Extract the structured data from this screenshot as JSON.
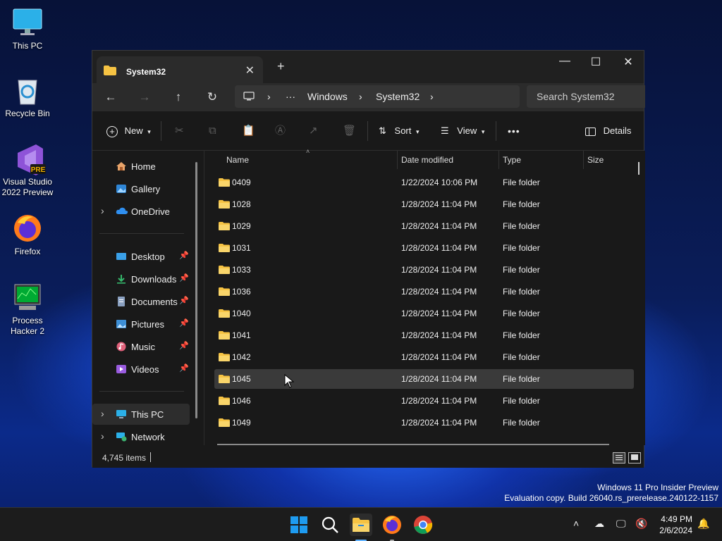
{
  "desktop": {
    "icons": [
      {
        "label": "This PC",
        "icon": "monitor-icon"
      },
      {
        "label": "Recycle Bin",
        "icon": "recycle-bin-icon"
      },
      {
        "label": "Visual Studio 2022 Preview",
        "icon": "visual-studio-icon",
        "badge": "PRE"
      },
      {
        "label": "Firefox",
        "icon": "firefox-icon"
      },
      {
        "label": "Process Hacker 2",
        "icon": "process-hacker-icon"
      }
    ],
    "watermark": {
      "line1": "Windows 11 Pro Insider Preview",
      "line2": "Evaluation copy. Build 26040.rs_prerelease.240122-1157"
    }
  },
  "explorer": {
    "tab_title": "System32",
    "tab_close": "✕",
    "new_tab": "+",
    "window_controls": {
      "minimize": "—",
      "maximize": "☐",
      "close": "✕"
    },
    "nav": {
      "back": "←",
      "forward": "→",
      "up": "↑",
      "refresh": "↻"
    },
    "breadcrumb": {
      "ellipsis": "···",
      "items": [
        "Windows",
        "System32"
      ],
      "separator": "›"
    },
    "search_placeholder": "Search System32",
    "toolbar": {
      "new_label": "New",
      "sort_label": "Sort",
      "view_label": "View",
      "more_label": "•••",
      "details_label": "Details"
    },
    "sidebar": {
      "top": [
        {
          "label": "Home",
          "icon": "home-icon"
        },
        {
          "label": "Gallery",
          "icon": "gallery-icon"
        },
        {
          "label": "OneDrive",
          "icon": "onedrive-icon",
          "expandable": true
        }
      ],
      "pinned": [
        {
          "label": "Desktop",
          "icon": "desktop-icon",
          "color": "#3aa0e8"
        },
        {
          "label": "Downloads",
          "icon": "download-icon",
          "color": "#35b86b"
        },
        {
          "label": "Documents",
          "icon": "document-icon",
          "color": "#8aa0c0"
        },
        {
          "label": "Pictures",
          "icon": "pictures-icon",
          "color": "#3d8fd6"
        },
        {
          "label": "Music",
          "icon": "music-icon",
          "color": "#e0607a"
        },
        {
          "label": "Videos",
          "icon": "videos-icon",
          "color": "#9a5ce0"
        }
      ],
      "bottom": [
        {
          "label": "This PC",
          "icon": "this-pc-icon",
          "selected": true
        },
        {
          "label": "Network",
          "icon": "network-icon"
        }
      ]
    },
    "columns": [
      "Name",
      "Date modified",
      "Type",
      "Size"
    ],
    "rows": [
      {
        "name": "0409",
        "date": "1/22/2024 10:06 PM",
        "type": "File folder"
      },
      {
        "name": "1028",
        "date": "1/28/2024 11:04 PM",
        "type": "File folder"
      },
      {
        "name": "1029",
        "date": "1/28/2024 11:04 PM",
        "type": "File folder"
      },
      {
        "name": "1031",
        "date": "1/28/2024 11:04 PM",
        "type": "File folder"
      },
      {
        "name": "1033",
        "date": "1/28/2024 11:04 PM",
        "type": "File folder"
      },
      {
        "name": "1036",
        "date": "1/28/2024 11:04 PM",
        "type": "File folder"
      },
      {
        "name": "1040",
        "date": "1/28/2024 11:04 PM",
        "type": "File folder"
      },
      {
        "name": "1041",
        "date": "1/28/2024 11:04 PM",
        "type": "File folder"
      },
      {
        "name": "1042",
        "date": "1/28/2024 11:04 PM",
        "type": "File folder"
      },
      {
        "name": "1045",
        "date": "1/28/2024 11:04 PM",
        "type": "File folder"
      },
      {
        "name": "1046",
        "date": "1/28/2024 11:04 PM",
        "type": "File folder"
      },
      {
        "name": "1049",
        "date": "1/28/2024 11:04 PM",
        "type": "File folder"
      }
    ],
    "status": {
      "item_count": "4,745 items"
    }
  },
  "taskbar": {
    "apps": [
      "start-icon",
      "search-icon",
      "file-explorer-icon",
      "firefox-icon",
      "chrome-icon"
    ],
    "clock": {
      "time": "4:49 PM",
      "date": "2/6/2024"
    }
  }
}
